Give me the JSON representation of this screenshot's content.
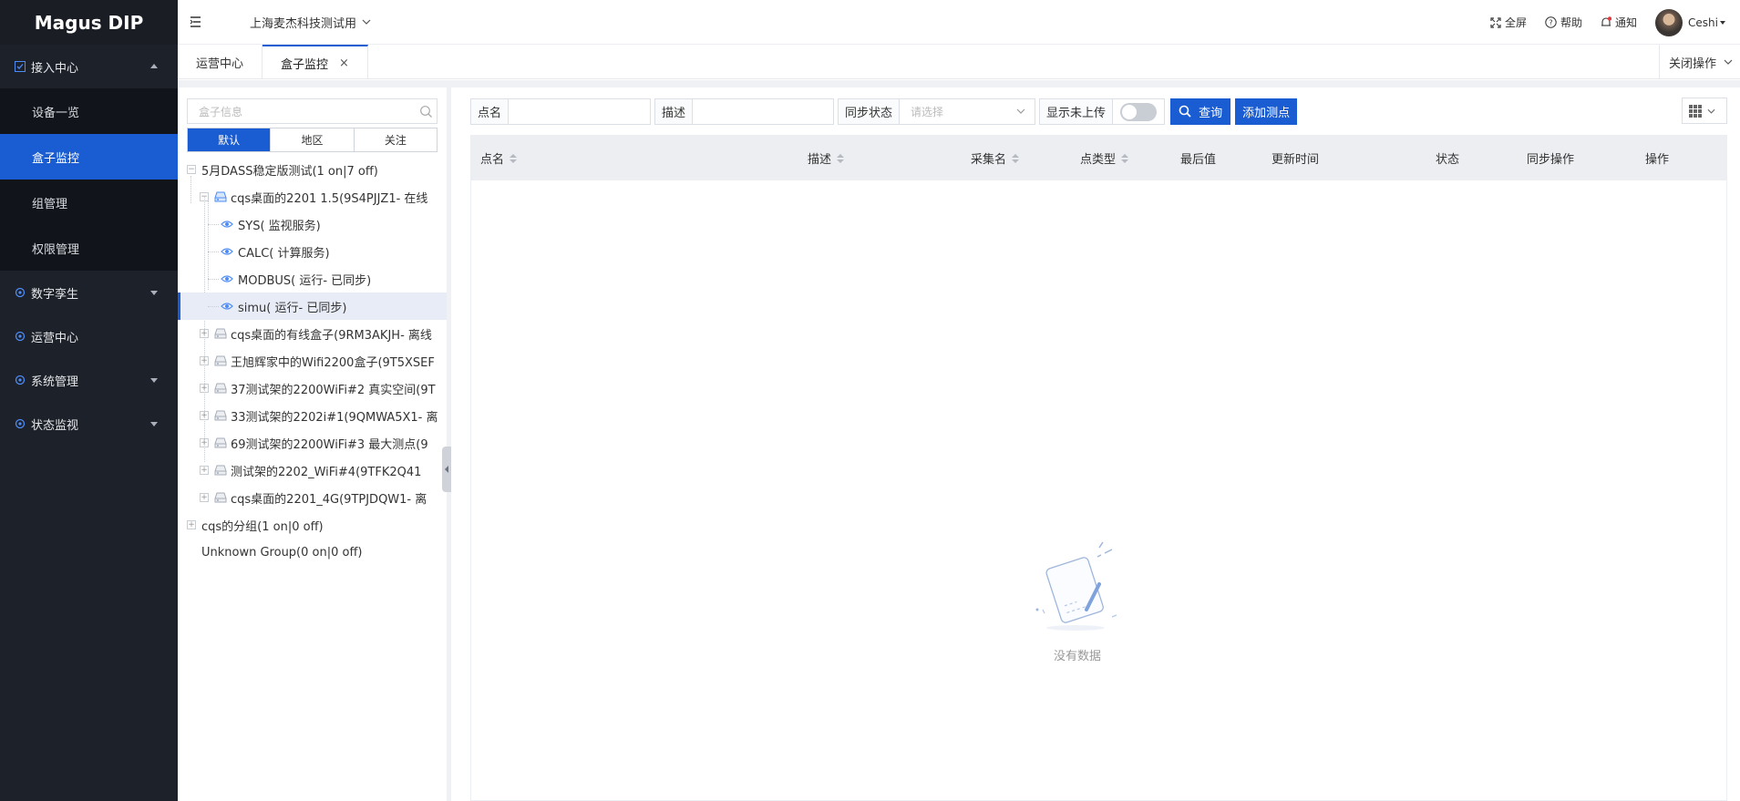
{
  "app": {
    "logo": "Magus DIP"
  },
  "sidebar": {
    "groups": [
      {
        "label": "接入中心",
        "expanded": true,
        "items": [
          {
            "label": "设备一览"
          },
          {
            "label": "盒子监控"
          },
          {
            "label": "组管理"
          },
          {
            "label": "权限管理"
          }
        ]
      },
      {
        "label": "数字孪生"
      },
      {
        "label": "运营中心"
      },
      {
        "label": "系统管理"
      },
      {
        "label": "状态监视"
      }
    ]
  },
  "header": {
    "org": "上海麦杰科技测试用",
    "actions": {
      "fullscreen": "全屏",
      "help": "帮助",
      "notify": "通知"
    },
    "user": "Ceshi"
  },
  "tabs": {
    "items": [
      {
        "label": "运营中心"
      },
      {
        "label": "盒子监控"
      }
    ],
    "close_ops": "关闭操作"
  },
  "tree_panel": {
    "search_placeholder": "盒子信息",
    "segments": [
      "默认",
      "地区",
      "关注"
    ],
    "nodes": {
      "g1": "5月DASS稳定版测试(1 on|7 off)",
      "b1": "cqs桌面的2201 1.5(9S4PJJZ1- 在线",
      "s1": "SYS( 监视服务)",
      "s2": "CALC( 计算服务)",
      "s3": "MODBUS( 运行- 已同步)",
      "s4": "simu( 运行- 已同步)",
      "b2": "cqs桌面的有线盒子(9RM3AKJH- 离线",
      "b3": "王旭辉家中的Wifi2200盒子(9T5XSEF",
      "b4": "37测试架的2200WiFi#2 真实空间(9T",
      "b5": "33测试架的2202i#1(9QMWA5X1- 离",
      "b6": "69测试架的2200WiFi#3 最大测点(9",
      "b7": "测试架的2202_WiFi#4(9TFK2Q41",
      "b8": "cqs桌面的2201_4G(9TPJDQW1- 离",
      "g2": "cqs的分组(1 on|0 off)",
      "g3": "Unknown Group(0 on|0 off)"
    }
  },
  "filters": {
    "point_name": {
      "label": "点名",
      "value": ""
    },
    "desc": {
      "label": "描述",
      "value": ""
    },
    "sync_status": {
      "label": "同步状态",
      "placeholder": "请选择"
    },
    "show_unuploaded": {
      "label": "显示未上传",
      "on": false
    },
    "query_btn": "查询",
    "add_btn": "添加测点"
  },
  "table": {
    "columns": [
      "点名",
      "描述",
      "采集名",
      "点类型",
      "最后值",
      "更新时间",
      "状态",
      "同步操作",
      "操作"
    ],
    "rows": [],
    "empty_text": "没有数据"
  },
  "colors": {
    "accent": "#1a5cd1",
    "sidebar_bg": "#1d2129",
    "submenu_bg": "#11141a"
  }
}
